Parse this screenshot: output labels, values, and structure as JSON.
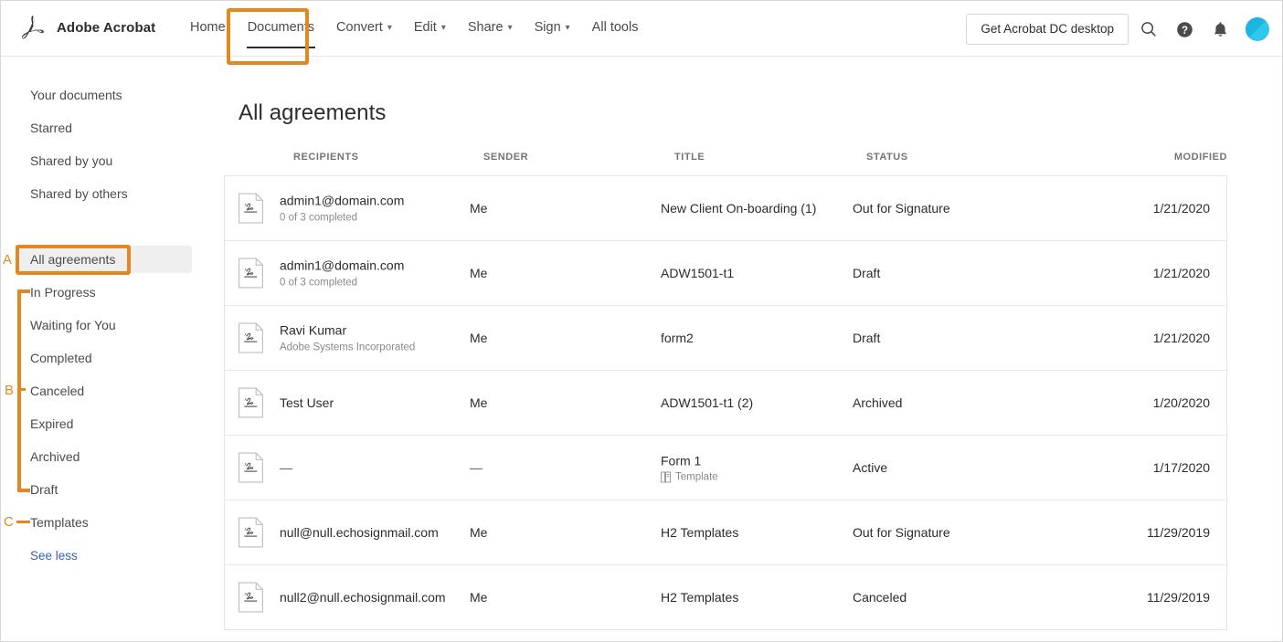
{
  "header": {
    "brand": "Adobe Acrobat",
    "nav": [
      {
        "label": "Home",
        "caret": false,
        "active": false
      },
      {
        "label": "Documents",
        "caret": false,
        "active": true
      },
      {
        "label": "Convert",
        "caret": true,
        "active": false
      },
      {
        "label": "Edit",
        "caret": true,
        "active": false
      },
      {
        "label": "Share",
        "caret": true,
        "active": false
      },
      {
        "label": "Sign",
        "caret": true,
        "active": false
      },
      {
        "label": "All tools",
        "caret": false,
        "active": false
      }
    ],
    "cta_label": "Get Acrobat DC desktop",
    "icons": [
      "search-icon",
      "help-icon",
      "bell-icon"
    ],
    "caret_glyph": "⌄"
  },
  "sidebar": {
    "items": [
      {
        "label": "Your documents",
        "selected": false
      },
      {
        "label": "Starred",
        "selected": false
      },
      {
        "label": "Shared by you",
        "selected": false
      },
      {
        "label": "Shared by others",
        "selected": false
      },
      {
        "label": "All agreements",
        "selected": true
      },
      {
        "label": "In Progress",
        "selected": false
      },
      {
        "label": "Waiting for You",
        "selected": false
      },
      {
        "label": "Completed",
        "selected": false
      },
      {
        "label": "Canceled",
        "selected": false
      },
      {
        "label": "Expired",
        "selected": false
      },
      {
        "label": "Archived",
        "selected": false
      },
      {
        "label": "Draft",
        "selected": false
      },
      {
        "label": "Templates",
        "selected": false
      }
    ],
    "see_less": "See less"
  },
  "main": {
    "title": "All agreements",
    "columns": [
      "RECIPIENTS",
      "SENDER",
      "TITLE",
      "STATUS",
      "MODIFIED"
    ],
    "rows": [
      {
        "recipient": "admin1@domain.com",
        "recipient_sub": "0 of 3 completed",
        "sender": "Me",
        "title": "New Client On-boarding (1)",
        "title_badge": "",
        "status": "Out for Signature",
        "modified": "1/21/2020"
      },
      {
        "recipient": "admin1@domain.com",
        "recipient_sub": "0 of 3 completed",
        "sender": "Me",
        "title": "ADW1501-t1",
        "title_badge": "",
        "status": "Draft",
        "modified": "1/21/2020"
      },
      {
        "recipient": "Ravi Kumar",
        "recipient_sub": "Adobe Systems Incorporated",
        "sender": "Me",
        "title": "form2",
        "title_badge": "",
        "status": "Draft",
        "modified": "1/21/2020"
      },
      {
        "recipient": "Test User",
        "recipient_sub": "",
        "sender": "Me",
        "title": "ADW1501-t1 (2)",
        "title_badge": "",
        "status": "Archived",
        "modified": "1/20/2020"
      },
      {
        "recipient": "—",
        "recipient_sub": "",
        "sender": "—",
        "title": "Form 1",
        "title_badge": "Template",
        "status": "Active",
        "modified": "1/17/2020"
      },
      {
        "recipient": "null@null.echosignmail.com",
        "recipient_sub": "",
        "sender": "Me",
        "title": "H2 Templates",
        "title_badge": "",
        "status": "Out for Signature",
        "modified": "11/29/2019"
      },
      {
        "recipient": "null2@null.echosignmail.com",
        "recipient_sub": "",
        "sender": "Me",
        "title": "H2 Templates",
        "title_badge": "",
        "status": "Canceled",
        "modified": "11/29/2019"
      }
    ]
  },
  "annotations": {
    "accent_color": "#e3871f",
    "letters": [
      "A",
      "B",
      "C"
    ]
  }
}
